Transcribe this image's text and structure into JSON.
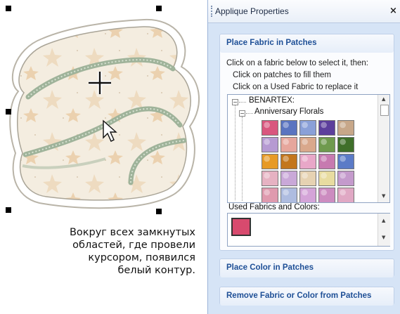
{
  "caption": "Вокруг всех замкнутых\nобластей, где провели\nкурсором, появился\nбелый контур.",
  "panel": {
    "title": "Applique Properties",
    "close_label": "×",
    "section1": {
      "header": "Place Fabric in Patches",
      "instructions": [
        "Click on a fabric below to select it, then:",
        "Click on patches to fill them",
        "Click on a Used Fabric to replace it"
      ],
      "tree_root": "BENARTEX:",
      "tree_child": "Anniversary Florals",
      "used_label": "Used Fabrics and Colors:"
    },
    "section2_header": "Place Color in Patches",
    "section3_header": "Remove Fabric or Color from Patches"
  },
  "colors": {
    "panel_bg": "#d6e4f6",
    "header_text": "#1e4f96",
    "fabric_cream": "#f4ede0",
    "fabric_peach": "#e8cba2",
    "stitch_green": "#9fb39a"
  },
  "icons": [
    "crosshair-cursor-icon",
    "arrow-cursor-icon",
    "collapse-icon",
    "close-icon"
  ],
  "swatches": [
    [
      "#d9567e",
      "#5a74c0",
      "#8aa0d8",
      "#5c3f9c",
      "#c7a789"
    ],
    [
      "#b69ad2",
      "#e6a69c",
      "#d9a88c",
      "#6f9a4e",
      "#3f6f2a"
    ],
    [
      "#e79a26",
      "#c3761c",
      "#e8a7c8",
      "#c77ab0",
      "#5b7bc7"
    ],
    [
      "#e6b2c2",
      "#c9a8d8",
      "#e6d2b2",
      "#e8dca0",
      "#c49acc"
    ],
    [
      "#df9aae",
      "#aebce0",
      "#d4a4d8",
      "#cc8cc0",
      "#e0a8c4"
    ]
  ],
  "used_swatch_color": "#d84a6e"
}
